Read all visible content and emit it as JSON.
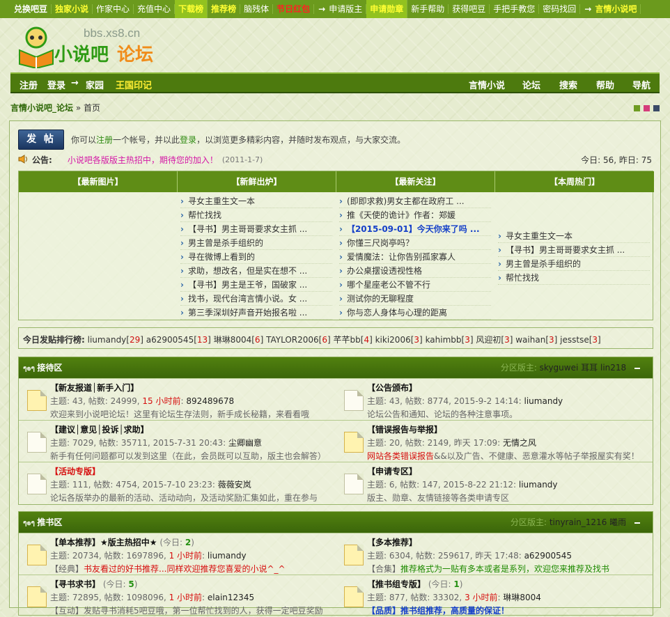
{
  "topbar": {
    "items": [
      "兑换吧豆",
      "独家小说",
      "作家中心",
      "充值中心",
      "下载榜",
      "推荐榜",
      "脑残体",
      "节日红包",
      "申请版主",
      "申请勋章",
      "新手帮助",
      "获得吧豆",
      "手把手教您",
      "密码找回",
      "言情小说吧"
    ]
  },
  "logo": {
    "domain": "bbs.xs8.cn",
    "name_green": "小说吧",
    "name_orange": "论坛"
  },
  "nav": {
    "register": "注册",
    "login": "登录",
    "home": "家园",
    "mark": "王国印记",
    "right": [
      "言情小说",
      "论坛",
      "搜索",
      "帮助",
      "导航"
    ]
  },
  "breadcrumb": {
    "site": "言情小说吧_论坛",
    "sep": " » ",
    "page": "首页"
  },
  "intro": {
    "post_button": "发 帖",
    "pre": "你可以",
    "register": "注册",
    "mid": "一个帐号，并以此",
    "login": "登录",
    "post": "，以浏览更多精彩内容，并随时发布观点，与大家交流。"
  },
  "notice": {
    "label": "公告:",
    "text": "小说吧各版版主热招中，期待您的加入！",
    "date": "(2011-1-7)",
    "stats": "今日: 56, 昨日: 75"
  },
  "grid": {
    "headers": [
      "【最新图片】",
      "【新鲜出炉】",
      "【最新关注】",
      "【本周热门】"
    ],
    "fresh": [
      "寻女主重生文一本",
      "帮忙找找",
      "【寻书】男主哥哥要求女主抓 ...",
      "男主曾是杀手组织的",
      "寻在微博上看到的",
      "求助，想改名，但是实在想不 ...",
      "【寻书】男主是王爷，国破家 ...",
      "找书，现代台湾言情小说。女 ...",
      "第三季深圳好声音开始报名啦 ..."
    ],
    "focus": [
      "(即即求救)男女主都在政府工 ...",
      "推《天使的诡计》作者：郑媛",
      "【2015-09-01】今天你来了吗 ...",
      "你懂三尺岗亭吗？",
      "爱情魔法：让你告别孤家寡人",
      "办公桌摆设透视性格",
      "哪个星座老公不管不行",
      "测试你的无聊程度",
      "你与恋人身体与心理的距离"
    ],
    "hot": [
      "寻女主重生文一本",
      "【寻书】男主哥哥要求女主抓 ...",
      "男主曾是杀手组织的",
      "帮忙找找"
    ]
  },
  "rank": {
    "label": "今日发贴排行榜:",
    "users": [
      {
        "name": "liumandy",
        "count": "29"
      },
      {
        "name": "a62900545",
        "count": "13"
      },
      {
        "name": "琳琳8004",
        "count": "6"
      },
      {
        "name": "TAYLOR2006",
        "count": "6"
      },
      {
        "name": "芊芊bb",
        "count": "4"
      },
      {
        "name": "kiki2006",
        "count": "3"
      },
      {
        "name": "kahimbb",
        "count": "3"
      },
      {
        "name": "风迎初",
        "count": "3"
      },
      {
        "name": "waihan",
        "count": "3"
      },
      {
        "name": "jesstse",
        "count": "3"
      }
    ]
  },
  "sections": [
    {
      "title": "接待区",
      "mod_label": "分区版主:",
      "mods": [
        "skyguwei",
        "耳耳",
        "lin218"
      ],
      "forums": [
        {
          "name": "【新友报道│新手入门】",
          "stats_pre": "主题: 43, 帖数: 24999, ",
          "time": "15 小时前",
          "user": "892489678",
          "desc": "欢迎来到小说吧论坛！这里有论坛生存法则，新手成长秘籍，来看看哦",
          "new": true
        },
        {
          "name": "【公告颁布】",
          "stats_pre": "主题: 43, 帖数: 8774, 2015-9-2 14:14: ",
          "time": "",
          "user": "liumandy",
          "desc": "论坛公告和通知、论坛的各种注意事项。",
          "new": false
        },
        {
          "name": "【建议│意见│投诉│求助】",
          "stats_pre": "主题: 7029, 帖数: 35711, 2015-7-31 20:43: ",
          "time": "",
          "user": "尘卿幽意",
          "desc": "新手有任何问题都可以发到这里（在此，会员既可以互助，版主也会解答）",
          "new": false
        },
        {
          "name": "【错误报告与举报】",
          "stats_pre": "主题: 20, 帖数: 2149, 昨天 17:09: ",
          "time": "",
          "user": "无情之风",
          "desc_red": "网站各类错误报告",
          "desc": "&&以及广告、不健康、恶意灌水等帖子举报屋实有奖！",
          "new": true
        },
        {
          "name": "【活动专版】",
          "red": true,
          "stats_pre": "主题: 111, 帖数: 4754, 2015-7-10 23:23: ",
          "time": "",
          "user": "薇薇安岚",
          "desc": "论坛各版举办的最新的活动、活动动向，及活动奖励汇集如此，重在参与",
          "new": false
        },
        {
          "name": "【申请专区】",
          "stats_pre": "主题: 6, 帖数: 147, 2015-8-22 21:12: ",
          "time": "",
          "user": "liumandy",
          "desc": "版主、勋章、友情链接等各类申请专区",
          "new": false
        }
      ]
    },
    {
      "title": "推书区",
      "mod_label": "分区版主:",
      "mods": [
        "tinyrain_1216",
        "曦雨"
      ],
      "forums": [
        {
          "name": "【单本推荐】★版主热招中★",
          "today_label": "(今日: ",
          "today": "2",
          "stats_pre": "主题: 20734, 帖数: 1697896, ",
          "time": "1 小时前",
          "user": "liumandy",
          "desc_pre": "【经典】",
          "desc_red": "书友看过的好书推荐...同样欢迎推荐您喜爱的小说^_^",
          "new": true
        },
        {
          "name": "【多本推荐】",
          "stats_pre": "主题: 6304, 帖数: 259617, 昨天 17:48: ",
          "time": "",
          "user": "a62900545",
          "desc_pre": "【合集】",
          "desc_grn": "推荐格式为一贴有多本或者是系列，欢迎您来推荐及找书",
          "new": true
        },
        {
          "name": "【寻书求书】",
          "today_label": "(今日: ",
          "today": "5",
          "stats_pre": "主题: 72895, 帖数: 1098096, ",
          "time": "1 小时前",
          "user": "elain12345",
          "desc_pre": "【互动】",
          "desc": "发贴寻书消耗5吧豆哦，第一位帮忙找到的人，获得一定吧豆奖励",
          "new": true
        },
        {
          "name": "【推书组专版】",
          "today_label": "(今日: ",
          "today": "1",
          "stats_pre": "主题: 877, 帖数: 33302, ",
          "time": "3 小时前",
          "user": "琳琳8004",
          "desc_pre": "",
          "desc_blu": "【品质】推书组推荐，高质量的保证！",
          "new": true
        }
      ]
    }
  ],
  "colors": {
    "topbar": "#6b9a1d",
    "nav": "#4d7a0e",
    "section_header": "#4a7a0e",
    "swatches": [
      "#6e9c22",
      "#d43d7a",
      "#3a4a66"
    ]
  }
}
